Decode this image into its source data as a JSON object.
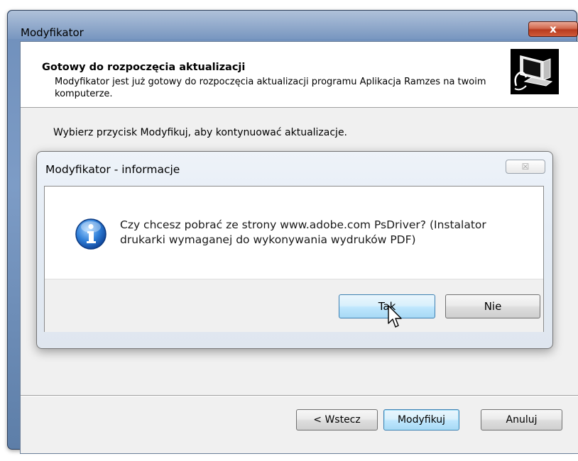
{
  "window": {
    "title": "Modyfikator",
    "close_label": "x"
  },
  "header": {
    "title": "Gotowy do rozpoczęcia aktualizacji",
    "subtitle": "Modyfikator jest już gotowy do rozpoczęcia aktualizacji programu Aplikacja Ramzes na twoim komputerze.",
    "logo_icon": "computer-install-icon"
  },
  "main": {
    "instruction": "Wybierz przycisk Modyfikuj, aby kontynuować aktualizacje."
  },
  "dialog": {
    "title": "Modyfikator - informacje",
    "close_label": "☒",
    "icon": "information-icon",
    "message": "Czy chcesz pobrać ze strony www.adobe.com PsDriver? (Instalator drukarki wymaganej do wykonywania wydruków PDF)",
    "yes_label": "Tak",
    "no_label": "Nie"
  },
  "footer": {
    "back_label": "< Wstecz",
    "modify_label": "Modyfikuj",
    "cancel_label": "Anuluj"
  }
}
